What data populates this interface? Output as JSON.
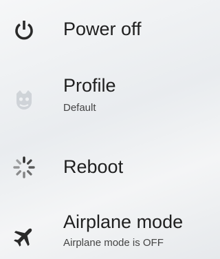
{
  "menu": {
    "items": [
      {
        "id": "power",
        "label": "Power off",
        "icon": "power-icon"
      },
      {
        "id": "profile",
        "label": "Profile",
        "subtitle": "Default",
        "icon": "profile-icon"
      },
      {
        "id": "reboot",
        "label": "Reboot",
        "icon": "reboot-icon"
      },
      {
        "id": "airplane",
        "label": "Airplane mode",
        "subtitle": "Airplane mode is OFF",
        "icon": "airplane-icon"
      }
    ]
  },
  "colors": {
    "text": "#1f1f1f",
    "subtext": "#444444",
    "icon": "#2a2a2a",
    "background": "#eef0f2"
  }
}
